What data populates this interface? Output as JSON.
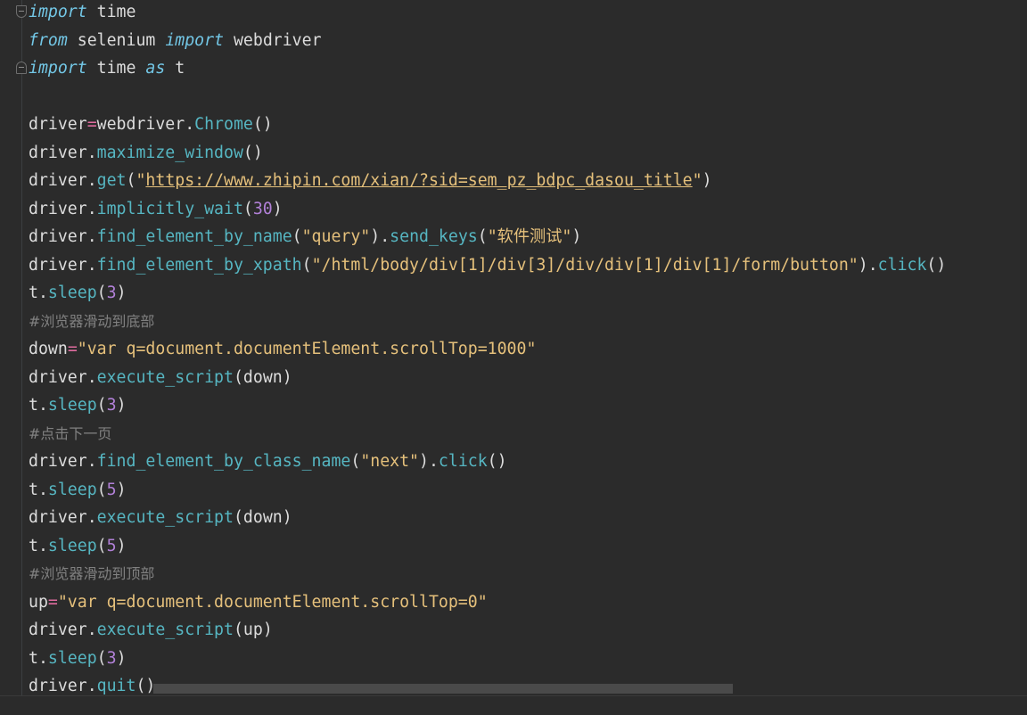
{
  "code": {
    "l1": {
      "kw1": "import",
      "t1": " time"
    },
    "l2": {
      "kw1": "from",
      "t1": " selenium ",
      "kw2": "import",
      "t2": " webdriver"
    },
    "l3": {
      "kw1": "import",
      "t1": " time ",
      "kw2": "as",
      "t2": " t"
    },
    "l5": {
      "t1": "driver",
      "op": "=",
      "t2": "webdriver.",
      "fn": "Chrome",
      "t3": "()"
    },
    "l6": {
      "t1": "driver.",
      "fn": "maximize_window",
      "t2": "()"
    },
    "l7": {
      "t1": "driver.",
      "fn": "get",
      "t2": "(",
      "q1": "\"",
      "url": "https://www.zhipin.com/xian/?sid=sem_pz_bdpc_dasou_title",
      "q2": "\"",
      "t3": ")"
    },
    "l8": {
      "t1": "driver.",
      "fn": "implicitly_wait",
      "t2": "(",
      "num": "30",
      "t3": ")"
    },
    "l9": {
      "t1": "driver.",
      "fn1": "find_element_by_name",
      "t2": "(",
      "s1": "\"query\"",
      "t3": ").",
      "fn2": "send_keys",
      "t4": "(",
      "s2a": "\"",
      "s2cn": "软件测试",
      "s2b": "\"",
      "t5": ")"
    },
    "l10": {
      "t1": "driver.",
      "fn1": "find_element_by_xpath",
      "t2": "(",
      "s1": "\"/html/body/div[1]/div[3]/div/div[1]/div[1]/form/button\"",
      "t3": ").",
      "fn2": "click",
      "t4": "()"
    },
    "l11": {
      "t1": "t.",
      "fn": "sleep",
      "t2": "(",
      "num": "3",
      "t3": ")"
    },
    "l12": {
      "cmt": "#浏览器滑动到底部"
    },
    "l13": {
      "t1": "down",
      "op": "=",
      "s1": "\"var q=document.documentElement.scrollTop=1000\""
    },
    "l14": {
      "t1": "driver.",
      "fn": "execute_script",
      "t2": "(down)"
    },
    "l15": {
      "t1": "t.",
      "fn": "sleep",
      "t2": "(",
      "num": "3",
      "t3": ")"
    },
    "l16": {
      "cmt": "#点击下一页"
    },
    "l17": {
      "t1": "driver.",
      "fn1": "find_element_by_class_name",
      "t2": "(",
      "s1": "\"next\"",
      "t3": ").",
      "fn2": "click",
      "t4": "()"
    },
    "l18": {
      "t1": "t.",
      "fn": "sleep",
      "t2": "(",
      "num": "5",
      "t3": ")"
    },
    "l19": {
      "t1": "driver.",
      "fn": "execute_script",
      "t2": "(down)"
    },
    "l20": {
      "t1": "t.",
      "fn": "sleep",
      "t2": "(",
      "num": "5",
      "t3": ")"
    },
    "l21": {
      "cmt": "#浏览器滑动到顶部"
    },
    "l22": {
      "t1": "up",
      "op": "=",
      "s1": "\"var q=document.documentElement.scrollTop=0\""
    },
    "l23": {
      "t1": "driver.",
      "fn": "execute_script",
      "t2": "(up)"
    },
    "l24": {
      "t1": "t.",
      "fn": "sleep",
      "t2": "(",
      "num": "3",
      "t3": ")"
    },
    "l25": {
      "t1": "driver.",
      "fn": "quit",
      "t2": "()"
    }
  },
  "colors": {
    "background": "#2b2b2b",
    "keyword": "#73c7e6",
    "function": "#56b6c2",
    "string": "#e5c07b",
    "number": "#b180d7",
    "operator": "#e06c9f",
    "comment": "#808080",
    "text": "#dcdcdc"
  },
  "icons": {
    "fold_top": "fold-collapse-icon",
    "fold_bottom": "fold-end-icon"
  }
}
